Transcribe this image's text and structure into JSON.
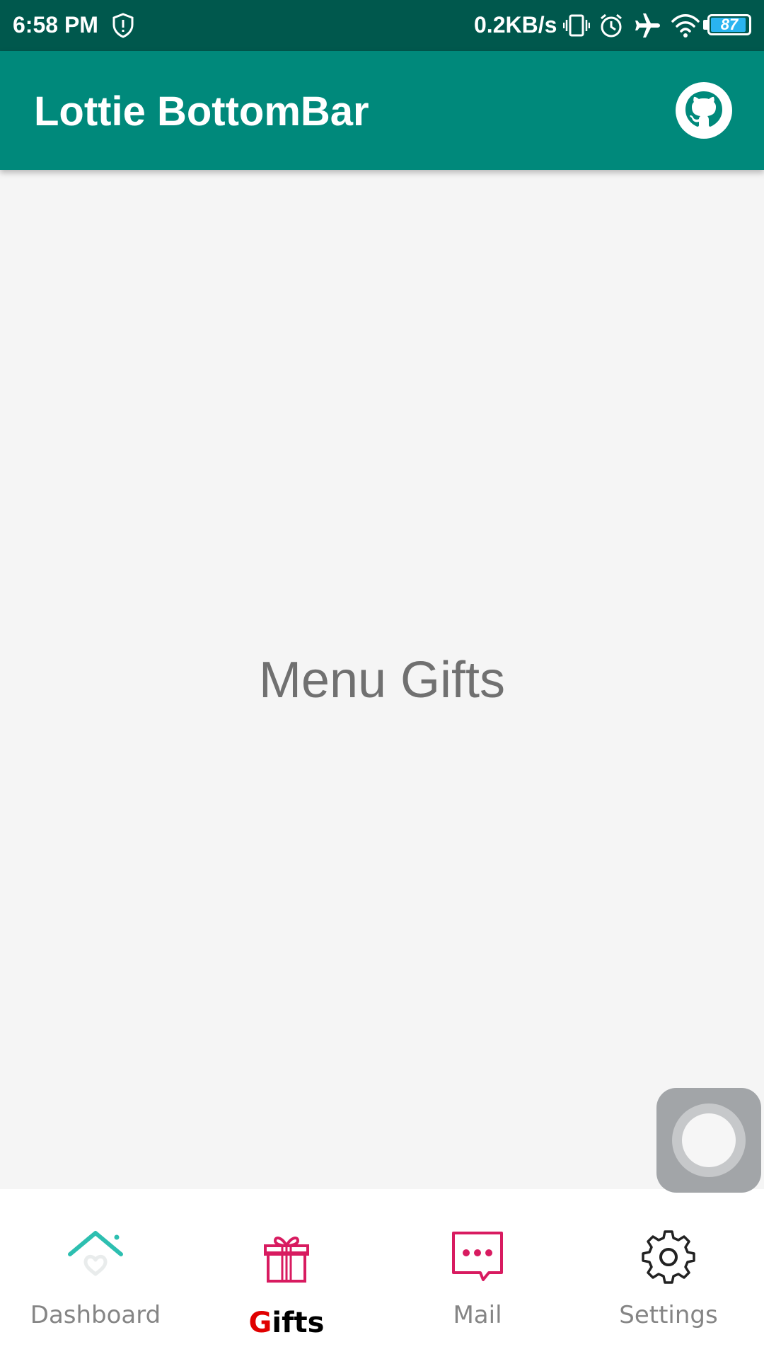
{
  "status_bar": {
    "time": "6:58 PM",
    "network_speed": "0.2KB/s",
    "battery_level": "87",
    "icons": [
      "shield-alert-icon",
      "vibrate-icon",
      "alarm-icon",
      "airplane-mode-icon",
      "wifi-icon",
      "battery-icon"
    ]
  },
  "app_bar": {
    "title": "Lottie BottomBar",
    "action_icon": "github-icon",
    "color": "#00897b"
  },
  "content": {
    "text": "Menu Gifts"
  },
  "bottom_nav": {
    "items": [
      {
        "label": "Dashboard",
        "icon": "home-heart-icon",
        "active": false
      },
      {
        "label_first": "G",
        "label_rest": "ifts",
        "label": "Gifts",
        "icon": "gift-icon",
        "active": true
      },
      {
        "label": "Mail",
        "icon": "chat-bubble-icon",
        "active": false
      },
      {
        "label": "Settings",
        "icon": "gear-icon",
        "active": false
      }
    ]
  },
  "colors": {
    "status_bar": "#00584d",
    "app_bar": "#00897b",
    "accent_pink": "#d81b60",
    "accent_teal": "#2dbfb0",
    "active_first_letter": "#e00000"
  }
}
